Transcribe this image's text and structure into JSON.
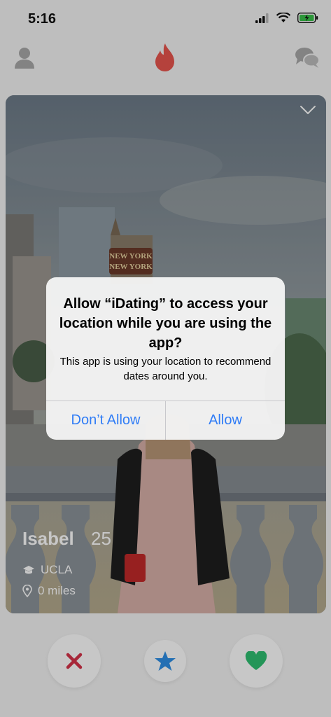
{
  "status_bar": {
    "time": "5:16"
  },
  "profile": {
    "name": "Isabel",
    "age": "25",
    "school": "UCLA",
    "distance": "0 miles"
  },
  "background_sign": [
    "NEW YORK",
    "NEW YORK"
  ],
  "alert": {
    "title": "Allow “iDating” to access your location while you are using the app?",
    "message": "This app is using your location to recommend dates around you.",
    "deny_label": "Don’t Allow",
    "allow_label": "Allow"
  },
  "colors": {
    "accent": "#e8554e",
    "nope": "#d6334a",
    "star": "#2e8fe6",
    "like": "#2fbf71",
    "alert_button": "#2f7cf6"
  },
  "icons": {
    "nav_left": "profile-icon",
    "nav_center": "flame-icon",
    "nav_right": "chat-icon"
  }
}
